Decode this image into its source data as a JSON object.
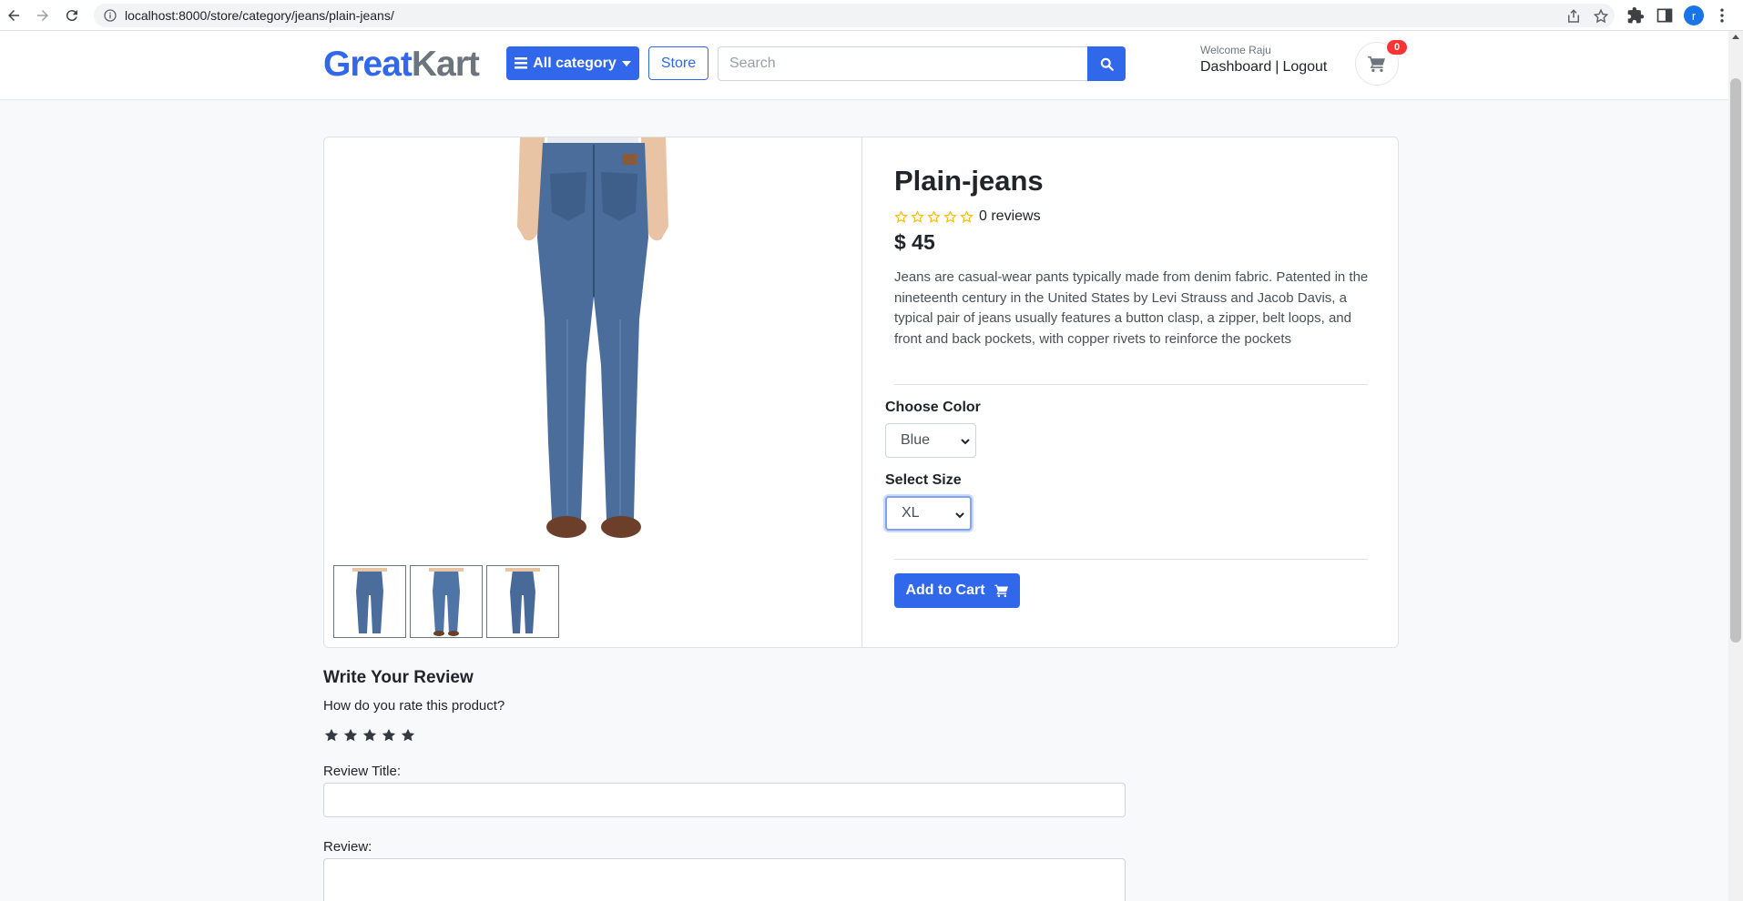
{
  "browser": {
    "url": "localhost:8000/store/category/jeans/plain-jeans/",
    "profile_initial": "r"
  },
  "header": {
    "logo_part1": "Great",
    "logo_part2": "Kart",
    "category_button": "All category",
    "store_button": "Store",
    "search_placeholder": "Search",
    "welcome": "Welcome Raju",
    "dashboard_link": "Dashboard",
    "separator": "|",
    "logout_link": "Logout",
    "cart_count": "0"
  },
  "product": {
    "title": "Plain-jeans",
    "rating_value": 0,
    "rating_max": 5,
    "reviews_text": "0 reviews",
    "price": "$ 45",
    "description": "Jeans are casual-wear pants typically made from denim fabric. Patented in the nineteenth century in the United States by Levi Strauss and Jacob Davis, a typical pair of jeans usually features a button clasp, a zipper, belt loops, and front and back pockets, with copper rivets to reinforce the pockets",
    "color_label": "Choose Color",
    "color_selected": "Blue",
    "size_label": "Select Size",
    "size_selected": "XL",
    "add_to_cart": "Add to Cart"
  },
  "review": {
    "heading": "Write Your Review",
    "question": "How do you rate this product?",
    "title_label": "Review Title:",
    "review_label": "Review:"
  },
  "colors": {
    "primary": "#3167eb",
    "badge": "#fa3434",
    "star": "#ffb800",
    "denim": "#4a6d9c"
  }
}
